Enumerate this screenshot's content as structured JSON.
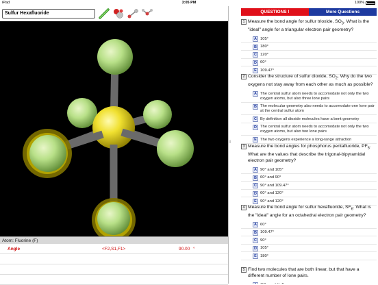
{
  "status_bar": {
    "carrier": "iPad",
    "time": "3:05 PM",
    "battery": "100%"
  },
  "toolbar": {
    "molecule_title": "Sulfur Hexafluoride",
    "tools": [
      "stick-model-icon",
      "ball-model-icon",
      "measure-distance-icon",
      "measure-angle-icon"
    ]
  },
  "viewer": {
    "central_atom": "S",
    "ligand_atoms": [
      "F1",
      "F2",
      "F3",
      "F4",
      "F5",
      "F6"
    ],
    "selected_color": "#c8b400"
  },
  "atom_info": "Atom: Fluorine (F)",
  "measurement": {
    "label": "Angle",
    "atoms": "<F2,S1,F1>",
    "value": "90.00",
    "unit": "°"
  },
  "header": {
    "questions_label": "QUESTIONS !",
    "more_label": "More Questions"
  },
  "questions": [
    {
      "num": "1",
      "text_html": "Measure the bond angle for sulfur trioxide, SO<sub>3</sub>. What is the \"ideal\" angle for a triangular electron pair geometry?",
      "answers": [
        {
          "letter": "A",
          "text": "105°"
        },
        {
          "letter": "B",
          "text": "180°"
        },
        {
          "letter": "C",
          "text": "120°"
        },
        {
          "letter": "D",
          "text": "60°"
        },
        {
          "letter": "E",
          "text": "109.47°"
        }
      ]
    },
    {
      "num": "2",
      "text_html": "Consider the structure of sulfur dioxide, SO<sub>2</sub>. Why do the two oxygens not stay away from each other as much as possible?",
      "answers": [
        {
          "letter": "A",
          "text": "The central sulfur atom needs to accomodate not only the two oxygen atoms, but also three lone pairs"
        },
        {
          "letter": "B",
          "text": "The molecular geometry also needs to accomodate one lone pair at the central sulfur atom"
        },
        {
          "letter": "C",
          "text": "By definition all dioxide molecules have a bent geometry"
        },
        {
          "letter": "D",
          "text": "The central sulfur atom needs to accomodate not only the two oxygen atoms, but also two lone pairs"
        },
        {
          "letter": "E",
          "text": "The two oxygens experience a long-range attraction"
        }
      ]
    },
    {
      "num": "3",
      "text_html": "Measure the bond angles for phosphorus pentafluoride, PF<sub>5</sub>. What are the values that describe the trigonal-bipyramidal electron pair geometry?",
      "answers": [
        {
          "letter": "A",
          "text": "90° and 105°"
        },
        {
          "letter": "B",
          "text": "60° and 90°"
        },
        {
          "letter": "C",
          "text": "90° and 109.47°"
        },
        {
          "letter": "D",
          "text": "60° and 120°"
        },
        {
          "letter": "E",
          "text": "90° and 120°"
        }
      ]
    },
    {
      "num": "4",
      "text_html": "Measure the bond angle for sulfur hexafluoride, SF<sub>6</sub>. What is the \"ideal\" angle for an octahedral electron pair geometry?",
      "answers": [
        {
          "letter": "A",
          "text": "60°"
        },
        {
          "letter": "B",
          "text": "109.47°"
        },
        {
          "letter": "C",
          "text": "90°"
        },
        {
          "letter": "D",
          "text": "105°"
        },
        {
          "letter": "E",
          "text": "180°"
        }
      ]
    },
    {
      "num": "5",
      "text_html": "Find two molecules that are both linear, but that have a different number of lone pairs.",
      "answers": [
        {
          "letter": "A",
          "text_html": "CO<sub>2</sub> and XeF<sub>2</sub>"
        }
      ]
    }
  ]
}
